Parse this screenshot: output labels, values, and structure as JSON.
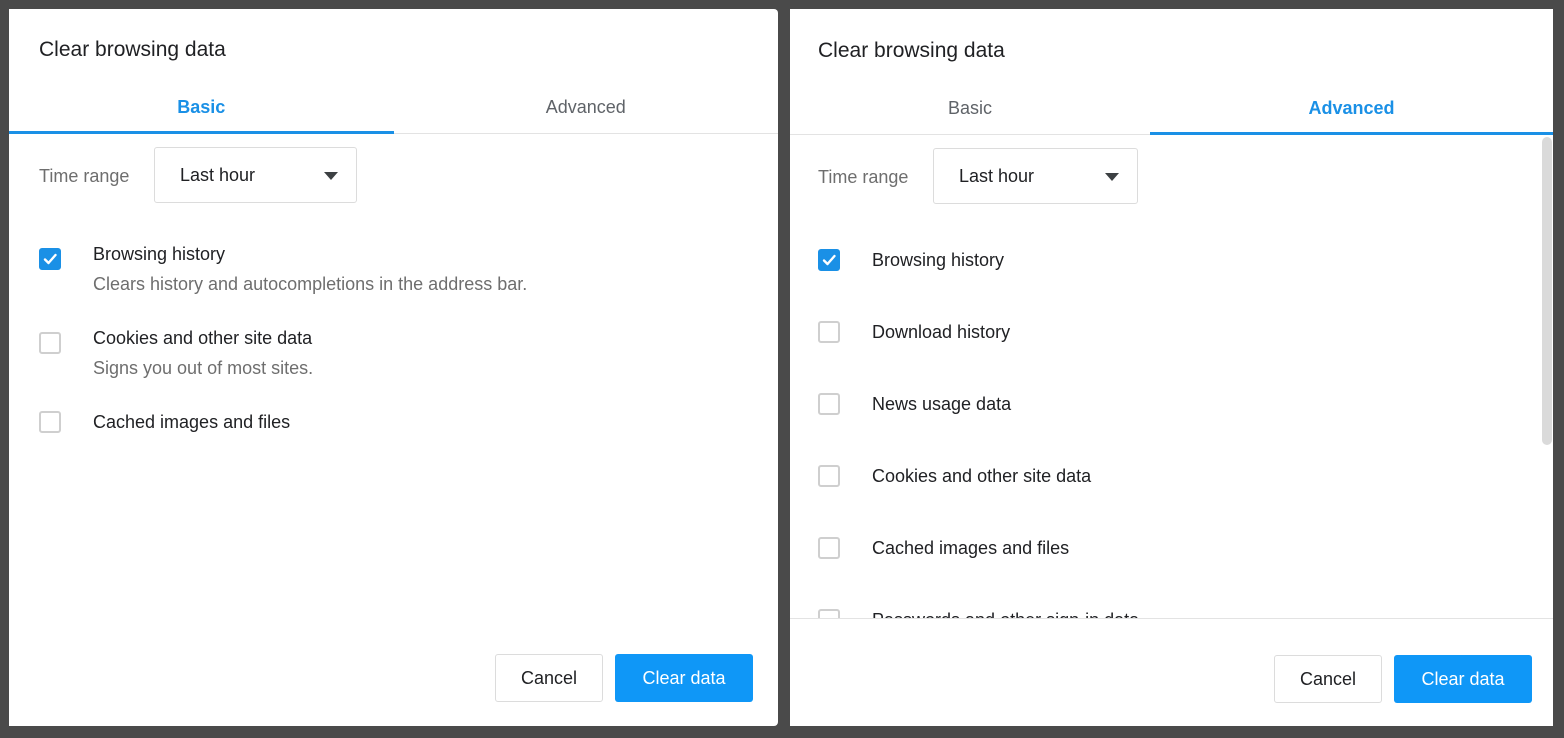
{
  "left_dialog": {
    "title": "Clear browsing data",
    "tabs": [
      {
        "label": "Basic",
        "active": true
      },
      {
        "label": "Advanced",
        "active": false
      }
    ],
    "time_range": {
      "label": "Time range",
      "value": "Last hour"
    },
    "options": [
      {
        "label": "Browsing history",
        "description": "Clears history and autocompletions in the address bar.",
        "checked": true
      },
      {
        "label": "Cookies and other site data",
        "description": "Signs you out of most sites.",
        "checked": false
      },
      {
        "label": "Cached images and files",
        "description": "",
        "checked": false
      }
    ],
    "buttons": {
      "cancel": "Cancel",
      "clear": "Clear data"
    }
  },
  "right_dialog": {
    "title": "Clear browsing data",
    "tabs": [
      {
        "label": "Basic",
        "active": false
      },
      {
        "label": "Advanced",
        "active": true
      }
    ],
    "time_range": {
      "label": "Time range",
      "value": "Last hour"
    },
    "options": [
      {
        "label": "Browsing history",
        "checked": true
      },
      {
        "label": "Download history",
        "checked": false
      },
      {
        "label": "News usage data",
        "checked": false
      },
      {
        "label": "Cookies and other site data",
        "checked": false
      },
      {
        "label": "Cached images and files",
        "checked": false
      },
      {
        "label": "Passwords and other sign-in data",
        "checked": false
      }
    ],
    "buttons": {
      "cancel": "Cancel",
      "clear": "Clear data"
    }
  },
  "colors": {
    "accent": "#1a90e6",
    "button": "#0f97f7",
    "backdrop": "#4a4a4a"
  },
  "icons": {
    "checkmark": "check-icon",
    "dropdown": "caret-down-icon"
  }
}
